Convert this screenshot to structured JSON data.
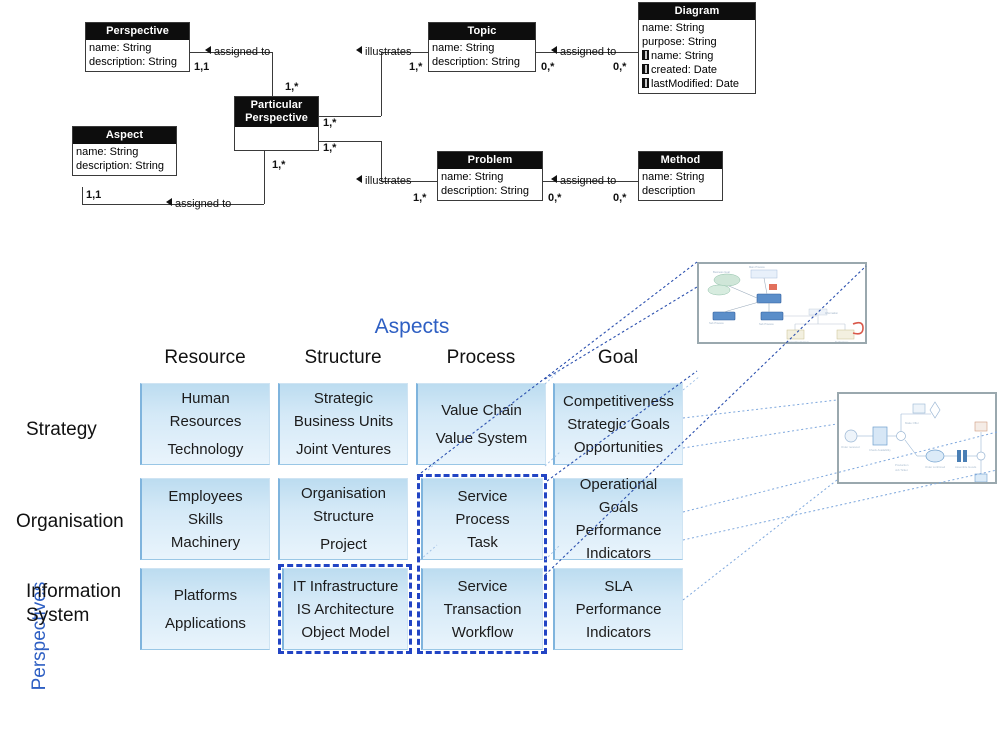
{
  "uml": {
    "classes": [
      {
        "id": "perspective",
        "name": "Perspective",
        "attributes": [
          "name: String",
          "description: String"
        ]
      },
      {
        "id": "particular",
        "name": "Particular Perspective",
        "attributes": []
      },
      {
        "id": "topic",
        "name": "Topic",
        "attributes": [
          "name: String",
          "description: String"
        ]
      },
      {
        "id": "diagram",
        "name": "Diagram",
        "attributes": [
          "name: String",
          "purpose: String"
        ],
        "private_attributes": [
          "name: String",
          "created: Date",
          "lastModified: Date"
        ]
      },
      {
        "id": "aspect",
        "name": "Aspect",
        "attributes": [
          "name: String",
          "description: String"
        ]
      },
      {
        "id": "problem",
        "name": "Problem",
        "attributes": [
          "name: String",
          "description: String"
        ]
      },
      {
        "id": "method",
        "name": "Method",
        "attributes": [
          "name: String",
          "description"
        ]
      }
    ],
    "associations": [
      {
        "label": "assigned to",
        "from": "perspective",
        "to": "particular",
        "from_card": "1,1",
        "to_card": "1,*"
      },
      {
        "label": "illustrates",
        "from": "particular",
        "to": "topic",
        "from_card": "1,*",
        "to_card": "1,*"
      },
      {
        "label": "assigned to",
        "from": "topic",
        "to": "diagram",
        "from_card": "0,*",
        "to_card": "0,*"
      },
      {
        "label": "assigned to",
        "from": "aspect",
        "to": "particular",
        "from_card": "1,1",
        "to_card": "1,*"
      },
      {
        "label": "illustrates",
        "from": "particular",
        "to": "problem",
        "from_card": "1,*",
        "to_card": "1,*"
      },
      {
        "label": "assigned to",
        "from": "problem",
        "to": "method",
        "from_card": "0,*",
        "to_card": "0,*"
      }
    ],
    "cardinality_labels": [
      "1,1",
      "1,*",
      "1,*",
      "1,*",
      "1,*",
      "1,*",
      "1,*",
      "0,*",
      "0,*",
      "0,*",
      "0,*",
      "1,1"
    ]
  },
  "matrix": {
    "title_columns": "Aspects",
    "title_rows": "Perspectives",
    "accent_color": "#2E5FC3",
    "columns": [
      "Resource",
      "Structure",
      "Process",
      "Goal"
    ],
    "rows": [
      "Strategy",
      "Organisation",
      "Information System"
    ],
    "cells": [
      [
        [
          "Human",
          "Resources",
          "",
          "Technology"
        ],
        [
          "Strategic",
          "Business Units",
          "",
          "Joint Ventures"
        ],
        [
          "Value Chain",
          "",
          "Value System"
        ],
        [
          "Competitiveness",
          "Strategic Goals",
          "Opportunities"
        ]
      ],
      [
        [
          "Employees",
          "Skills",
          "Machinery"
        ],
        [
          "Organisation",
          "Structure",
          "",
          "Project"
        ],
        [
          "Service",
          "Process",
          "Task"
        ],
        [
          "Operational",
          "Goals",
          "Performance",
          "Indicators"
        ]
      ],
      [
        [
          "Platforms",
          "",
          "Applications"
        ],
        [
          "IT Infrastructure",
          "IS Architecture",
          "Object Model"
        ],
        [
          "Service",
          "Transaction",
          "Workflow"
        ],
        [
          "SLA",
          "Performance",
          "Indicators"
        ]
      ]
    ],
    "selections": [
      {
        "name": "process-column-selection",
        "color": "#2244c4"
      },
      {
        "name": "it-infrastructure-selection",
        "color": "#2244c4"
      }
    ],
    "thumbnails": [
      {
        "name": "architecture-diagram-thumbnail"
      },
      {
        "name": "process-flow-diagram-thumbnail"
      }
    ]
  }
}
